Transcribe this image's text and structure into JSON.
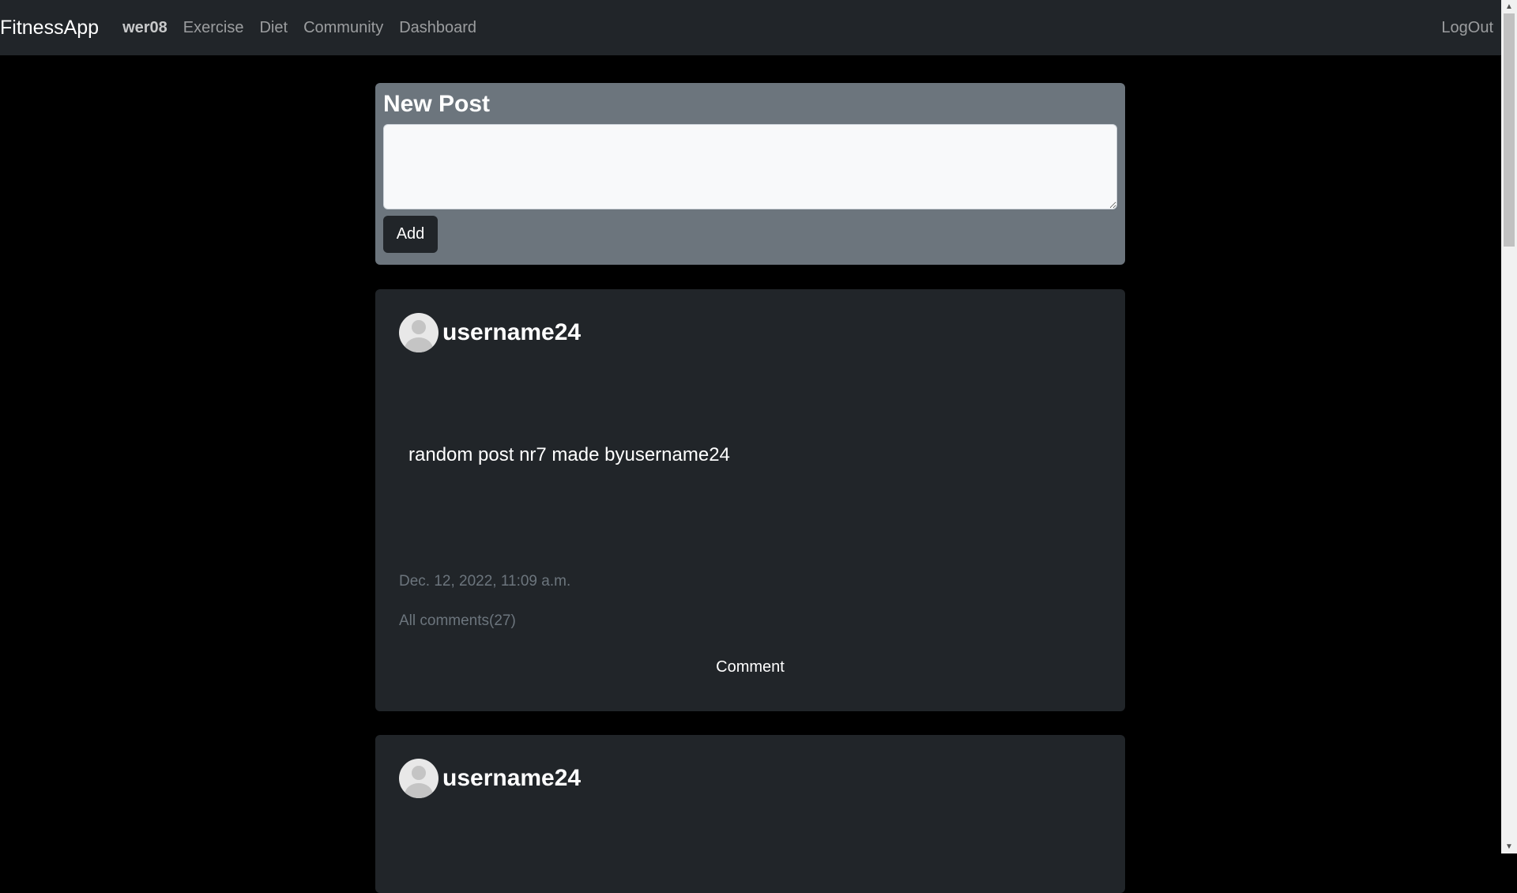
{
  "navbar": {
    "brand": "FitnessApp",
    "user": "wer08",
    "links": [
      "Exercise",
      "Diet",
      "Community",
      "Dashboard"
    ],
    "logout": "LogOut"
  },
  "new_post": {
    "title": "New Post",
    "placeholder": "",
    "add_label": "Add"
  },
  "posts": [
    {
      "username": "username24",
      "text": "random post nr7 made byusername24",
      "date": "Dec. 12, 2022, 11:09 a.m.",
      "comments": "All comments(27)",
      "comment_label": "Comment"
    },
    {
      "username": "username24"
    }
  ],
  "icons": {
    "avatar": "user-avatar-icon",
    "scroll_up": "scroll-up-arrow-icon",
    "scroll_down": "scroll-down-arrow-icon"
  },
  "colors": {
    "navbar_bg": "#212529",
    "page_bg": "#000000",
    "new_post_bg": "#6c757d",
    "post_bg": "#212529",
    "muted_text": "#6c757d"
  }
}
